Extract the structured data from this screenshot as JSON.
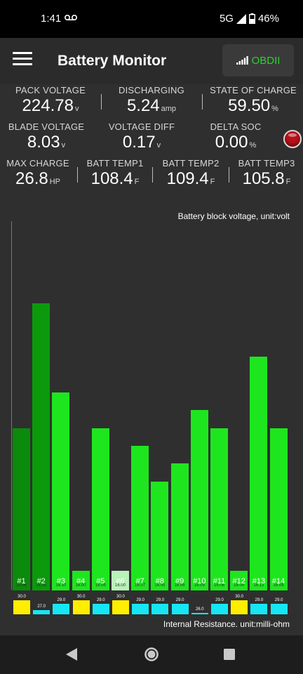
{
  "status_bar": {
    "time": "1:41",
    "network": "5G",
    "battery": "46%"
  },
  "app_bar": {
    "title": "Battery Monitor",
    "connect_label": "OBDII"
  },
  "metrics": [
    {
      "label": "PACK VOLTAGE",
      "value": "224.78",
      "unit": "v"
    },
    {
      "label": "DISCHARGING",
      "value": "5.24",
      "unit": "amp"
    },
    {
      "label": "STATE OF CHARGE",
      "value": "59.50",
      "unit": "%"
    },
    {
      "label": "BLADE VOLTAGE",
      "value": "8.03",
      "unit": "v"
    },
    {
      "label": "VOLTAGE DIFF",
      "value": "0.17",
      "unit": "v"
    },
    {
      "label": "DELTA SOC",
      "value": "0.00",
      "unit": "%"
    },
    {
      "label": "MAX CHARGE",
      "value": "26.8",
      "unit": "HP"
    },
    {
      "label": "BATT TEMP1",
      "value": "108.4",
      "unit": "F"
    },
    {
      "label": "BATT TEMP2",
      "value": "109.4",
      "unit": "F"
    },
    {
      "label": "BATT TEMP3",
      "value": "105.8",
      "unit": "F"
    }
  ],
  "chart_data": [
    {
      "type": "bar",
      "title": "Battery block voltage, unit:volt",
      "categories": [
        "#1",
        "#2",
        "#3",
        "#4",
        "#5",
        "#6",
        "#7",
        "#8",
        "#9",
        "#10",
        "#11",
        "#12",
        "#13",
        "#14"
      ],
      "values": [
        16.08,
        16.15,
        16.1,
        16.0,
        16.08,
        16.0,
        16.07,
        16.05,
        16.06,
        16.09,
        16.08,
        16.0,
        16.12,
        16.08
      ],
      "value_labels": [
        "16.08",
        "16.15",
        "16.10",
        "16.00",
        "16.08",
        "16.00",
        "16.07",
        "16.05",
        "16.06",
        "16.09",
        "16.08",
        "16.00",
        "16.12",
        "16.08"
      ],
      "colors": [
        "#0b8b0b",
        "#0b9a0b",
        "#1ee61e",
        "#1ee61e",
        "#1ee61e",
        "#b8f2b8",
        "#1ee61e",
        "#1ee61e",
        "#1ee61e",
        "#1ee61e",
        "#1ee61e",
        "#1ee61e",
        "#1ee61e",
        "#1ee61e"
      ],
      "ylim": [
        15.989,
        16.162
      ]
    },
    {
      "type": "bar",
      "title": "Internal Resistance. unit:milli-ohm",
      "categories": [
        "#1",
        "#2",
        "#3",
        "#4",
        "#5",
        "#6",
        "#7",
        "#8",
        "#9",
        "#10",
        "#11",
        "#12",
        "#13",
        "#14"
      ],
      "values": [
        30.0,
        27.0,
        29.0,
        30.0,
        29.0,
        30.0,
        29.0,
        29.0,
        29.0,
        26.0,
        29.0,
        30.0,
        29.0,
        29.0
      ],
      "value_labels": [
        "30.0",
        "27.0",
        "29.0",
        "30.0",
        "29.0",
        "30.0",
        "29.0",
        "29.0",
        "29.0",
        "26.0",
        "29.0",
        "30.0",
        "29.0",
        "29.0"
      ],
      "colors": [
        "#ffee00",
        "#16e6f4",
        "#16e6f4",
        "#ffee00",
        "#16e6f4",
        "#ffee00",
        "#16e6f4",
        "#16e6f4",
        "#16e6f4",
        "#16e6f4",
        "#16e6f4",
        "#ffee00",
        "#16e6f4",
        "#16e6f4"
      ],
      "ylim": [
        25.7,
        30.0
      ]
    }
  ]
}
